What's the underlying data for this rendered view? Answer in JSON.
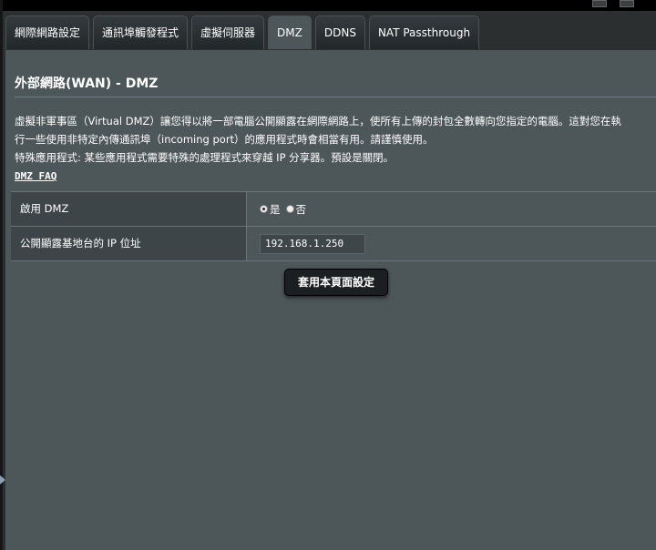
{
  "tabs": [
    {
      "label": "網際網路設定"
    },
    {
      "label": "通訊埠觸發程式"
    },
    {
      "label": "虛擬伺服器"
    },
    {
      "label": "DMZ"
    },
    {
      "label": "DDNS"
    },
    {
      "label": "NAT Passthrough"
    }
  ],
  "page": {
    "title": "外部網路(WAN) - DMZ",
    "desc_line1": "虛擬非軍事區（Virtual DMZ）讓您得以將一部電腦公開顯露在網際網路上，使所有上傳的封包全數轉向您指定的電腦。這對您在執",
    "desc_line2": "行一些使用非特定內傳通訊埠（incoming port）的應用程式時會相當有用。請謹慎使用。",
    "desc_line3": "特殊應用程式: 某些應用程式需要特殊的處理程式來穿越 IP 分享器。預設是關閉。",
    "faq_link": "DMZ FAQ"
  },
  "form": {
    "enable_label": "啟用 DMZ",
    "yes_label": "是",
    "no_label": "否",
    "selected": "yes",
    "ip_label": "公開顯露基地台的 IP 位址",
    "ip_value": "192.168.1.250"
  },
  "apply_label": "套用本頁面設定"
}
